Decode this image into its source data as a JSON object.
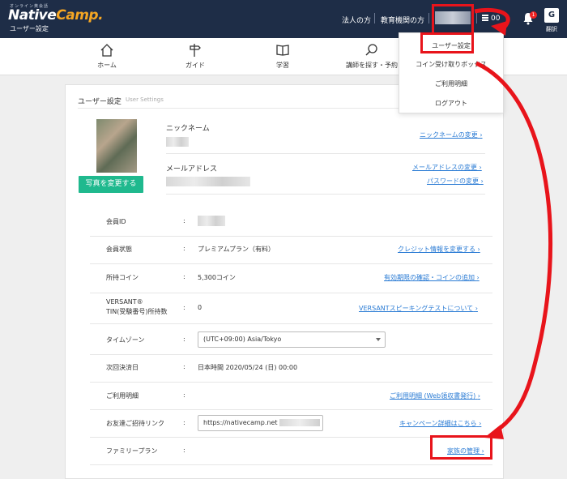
{
  "header": {
    "logo_small": "オンライン英会話",
    "logo_native": "Native",
    "logo_camp": "Camp.",
    "subtitle": "ユーザー設定",
    "links": [
      "法人の方",
      "教育機関の方"
    ],
    "coins_partial": "00",
    "notification_count": "1",
    "translate_glyph": "G",
    "translate_label": "翻訳",
    "icons": [
      "coin-icon",
      "bell-icon",
      "translate-icon"
    ]
  },
  "nav": {
    "items": [
      {
        "label": "ホーム",
        "icon": "home-icon"
      },
      {
        "label": "ガイド",
        "icon": "signpost-icon"
      },
      {
        "label": "学習",
        "icon": "book-icon"
      },
      {
        "label": "講師を探す・予約",
        "icon": "search-icon"
      }
    ]
  },
  "dropdown": {
    "items": [
      "ユーザー設定",
      "コイン受け取りボックス",
      "ご利用明細",
      "ログアウト"
    ]
  },
  "settings": {
    "title": "ユーザー設定",
    "title_en": "User Settings",
    "change_photo": "写真を変更する",
    "nickname_label": "ニックネーム",
    "nickname_change": "ニックネームの変更",
    "email_label": "メールアドレス",
    "email_change": "メールアドレスの変更",
    "password_change": "パスワードの変更",
    "rows": {
      "member_id": {
        "label": "会員ID",
        "colon": ":"
      },
      "status": {
        "label": "会員状態",
        "colon": ":",
        "value": "プレミアムプラン（有料）",
        "link": "クレジット情報を変更する"
      },
      "coins": {
        "label": "所持コイン",
        "colon": ":",
        "value": "5,300コイン",
        "link": "有効期限の確認・コインの追加"
      },
      "versant": {
        "label_line1": "VERSANT®",
        "label_line2": "TIN(受験番号)所持数",
        "colon": ":",
        "value": "0",
        "link": "VERSANTスピーキングテストについて"
      },
      "timezone": {
        "label": "タイムゾーン",
        "colon": ":",
        "value": "(UTC+09:00) Asia/Tokyo"
      },
      "next_payment": {
        "label": "次回決済日",
        "colon": ":",
        "value": "日本時間 2020/05/24 (日) 00:00"
      },
      "usage": {
        "label": "ご利用明細",
        "colon": ":",
        "link": "ご利用明細 (Web領収書発行)"
      },
      "invite": {
        "label": "お友達ご招待リンク",
        "colon": ":",
        "value": "https://nativecamp.net",
        "link": "キャンペーン詳細はこちら"
      },
      "family": {
        "label": "ファミリープラン",
        "colon": ":",
        "link": "家族の管理"
      }
    },
    "chevron": "›"
  },
  "colors": {
    "header_bg": "#1e2d47",
    "accent_green": "#1fb98e",
    "link_blue": "#2a7bd4",
    "annotation_red": "#e8141b"
  }
}
